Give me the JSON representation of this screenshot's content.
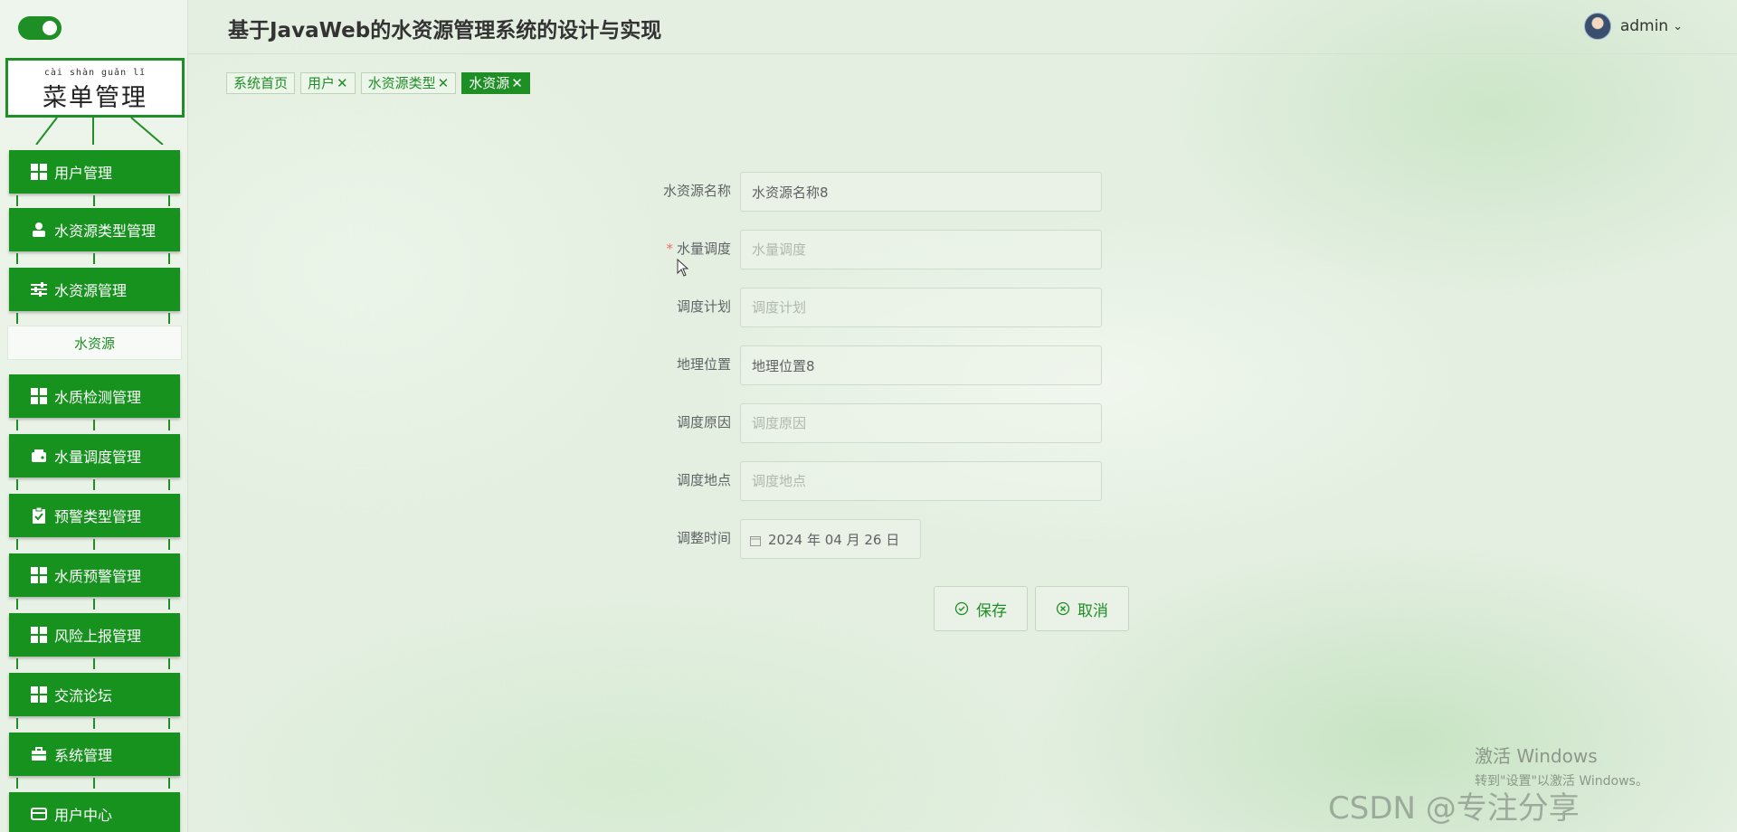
{
  "sidebar": {
    "title_pinyin": "cài shàn guǎn lǐ",
    "title": "菜单管理",
    "items": [
      {
        "label": "用户管理",
        "icon": "grid-icon"
      },
      {
        "label": "水资源类型管理",
        "icon": "user-icon"
      },
      {
        "label": "水资源管理",
        "icon": "sliders-icon"
      },
      {
        "label": "水资源",
        "icon": "",
        "sub": true
      },
      {
        "label": "水质检测管理",
        "icon": "grid-icon"
      },
      {
        "label": "水量调度管理",
        "icon": "wallet-icon"
      },
      {
        "label": "预警类型管理",
        "icon": "clipboard-check-icon"
      },
      {
        "label": "水质预警管理",
        "icon": "grid-icon"
      },
      {
        "label": "风险上报管理",
        "icon": "grid-icon"
      },
      {
        "label": "交流论坛",
        "icon": "grid-icon"
      },
      {
        "label": "系统管理",
        "icon": "briefcase-icon"
      },
      {
        "label": "用户中心",
        "icon": "card-icon"
      }
    ]
  },
  "header": {
    "title": "基于JavaWeb的水资源管理系统的设计与实现",
    "username": "admin"
  },
  "tags": [
    {
      "label": "系统首页",
      "closable": false,
      "active": false
    },
    {
      "label": "用户",
      "closable": true,
      "active": false
    },
    {
      "label": "水资源类型",
      "closable": true,
      "active": false
    },
    {
      "label": "水资源",
      "closable": true,
      "active": true
    }
  ],
  "form": {
    "name": {
      "label": "水资源名称",
      "value": "水资源名称8",
      "placeholder": "水资源名称"
    },
    "volume": {
      "label": "水量调度",
      "required": true,
      "value": "",
      "placeholder": "水量调度"
    },
    "plan": {
      "label": "调度计划",
      "value": "",
      "placeholder": "调度计划"
    },
    "location": {
      "label": "地理位置",
      "value": "地理位置8",
      "placeholder": "地理位置"
    },
    "reason": {
      "label": "调度原因",
      "value": "",
      "placeholder": "调度原因"
    },
    "place": {
      "label": "调度地点",
      "value": "",
      "placeholder": "调度地点"
    },
    "time": {
      "label": "调整时间",
      "value": "2024 年 04 月 26 日"
    }
  },
  "buttons": {
    "save": "保存",
    "cancel": "取消"
  },
  "watermark": {
    "line1": "激活 Windows",
    "line2": "转到\"设置\"以激活 Windows。",
    "csdn": "CSDN @专注分享"
  },
  "colors": {
    "primary": "#1d8f24",
    "required": "#f56c6c"
  }
}
